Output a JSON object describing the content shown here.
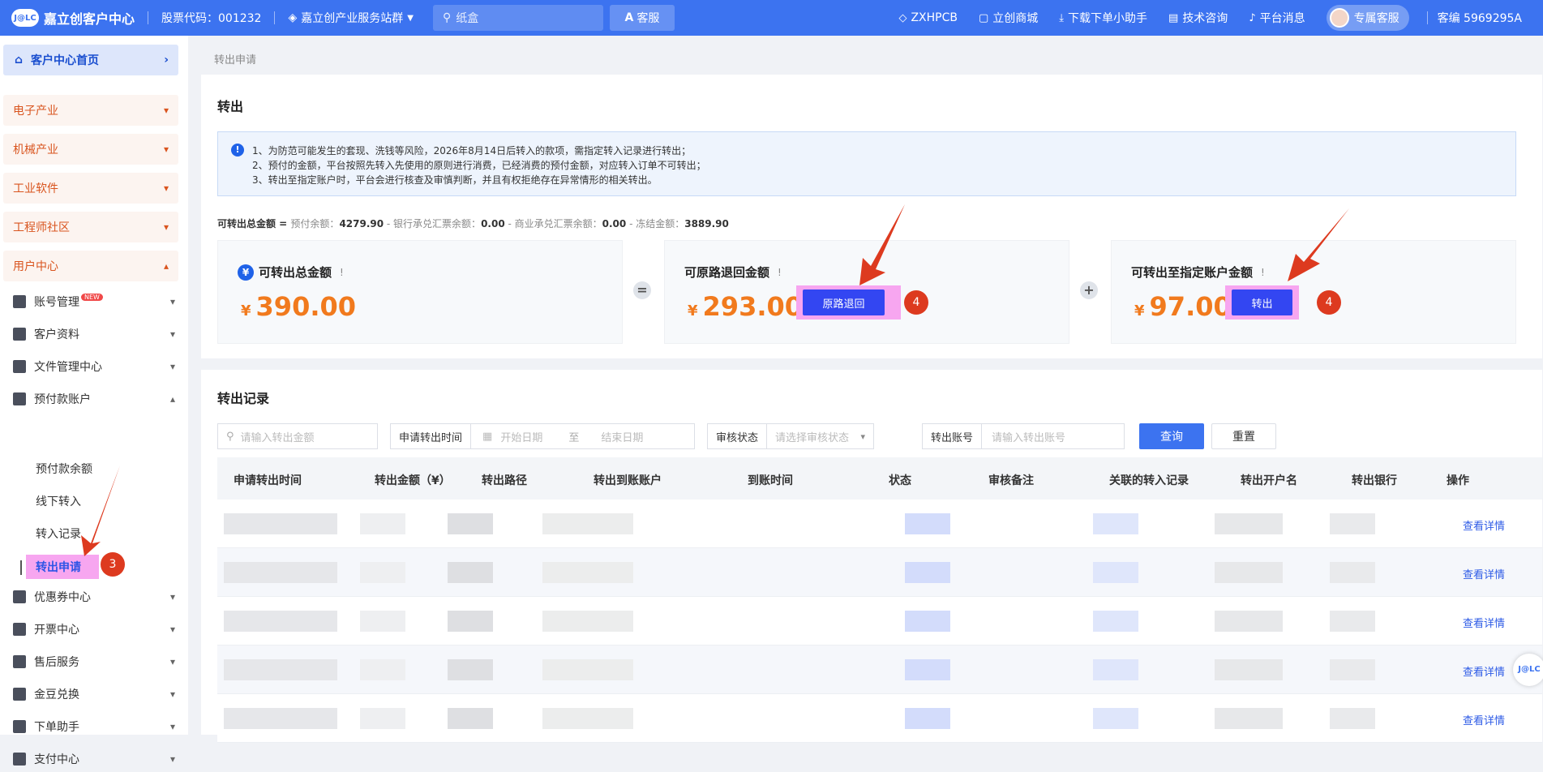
{
  "topbar": {
    "logo_mark": "J@LC",
    "app_title": "嘉立创客户中心",
    "stock_code": "股票代码：001232",
    "group_label": "嘉立创产业服务站群",
    "search_placeholder": "纸盒",
    "kefu": "客服",
    "links": [
      "ZXHPCB",
      "立创商城",
      "下载下单小助手",
      "技术咨询",
      "平台消息"
    ],
    "service": "专属客服",
    "account": "客编 5969295A"
  },
  "sidebar": {
    "home": "客户中心首页",
    "groups": [
      "电子产业",
      "机械产业",
      "工业软件",
      "工程师社区",
      "用户中心"
    ],
    "items": [
      "账号管理",
      "客户资料",
      "文件管理中心",
      "预付款账户",
      "优惠券中心",
      "开票中心",
      "售后服务",
      "金豆兑换",
      "下单助手",
      "支付中心"
    ],
    "new_badge": "NEW",
    "prepay_sub": [
      "预付款余额",
      "线下转入",
      "转入记录",
      "转出申请"
    ],
    "step_marker": "3"
  },
  "breadcrumb": "转出申请",
  "transfer": {
    "title": "转出",
    "notices": [
      "1、为防范可能发生的套现、洗钱等风险，2026年8月14日后转入的款项，需指定转入记录进行转出；",
      "2、预付的金额，平台按照先转入先使用的原则进行消费，已经消费的预付金额，对应转入订单不可转出；",
      "3、转出至指定账户时，平台会进行核查及审慎判断，并且有权拒绝存在异常情形的相关转出。"
    ],
    "formula": {
      "lead": "可转出总金额 = ",
      "prepay_label": "预付余额：",
      "prepay": "4279.90",
      "bank_label": " - 银行承兑汇票余额：",
      "bank": "0.00",
      "commercial_label": " - 商业承兑汇票余额：",
      "commercial": "0.00",
      "frozen_label": " - 冻结金额：",
      "frozen": "3889.90"
    },
    "total": {
      "label": "可转出总金额",
      "currency": "¥",
      "amount": "390.00"
    },
    "refund": {
      "label": "可原路退回金额",
      "currency": "¥",
      "amount": "293.00",
      "button": "原路退回"
    },
    "to_account": {
      "label": "可转出至指定账户金额",
      "currency": "¥",
      "amount": "97.00",
      "button": "转出"
    },
    "equals": "=",
    "plus": "+",
    "step_marker": "4",
    "hint": "!"
  },
  "records": {
    "title": "转出记录",
    "amount_placeholder": "请输入转出金额",
    "time_label": "申请转出时间",
    "start_placeholder": "开始日期",
    "range_sep": "至",
    "end_placeholder": "结束日期",
    "status_label": "审核状态",
    "status_placeholder": "请选择审核状态",
    "account_label": "转出账号",
    "account_placeholder": "请输入转出账号",
    "query": "查询",
    "reset": "重置",
    "columns": [
      "申请转出时间",
      "转出金额（¥）",
      "转出路径",
      "转出到账账户",
      "到账时间",
      "状态",
      "审核备注",
      "关联的转入记录",
      "转出开户名",
      "转出银行",
      "操作"
    ],
    "detail_link": "查看详情",
    "row_count": 5
  },
  "colors": {
    "primary": "#3c73f0",
    "amount": "#f17a1d",
    "highlight": "#f7a6f0",
    "button": "#3346f2",
    "marker": "#dd3a1f"
  }
}
